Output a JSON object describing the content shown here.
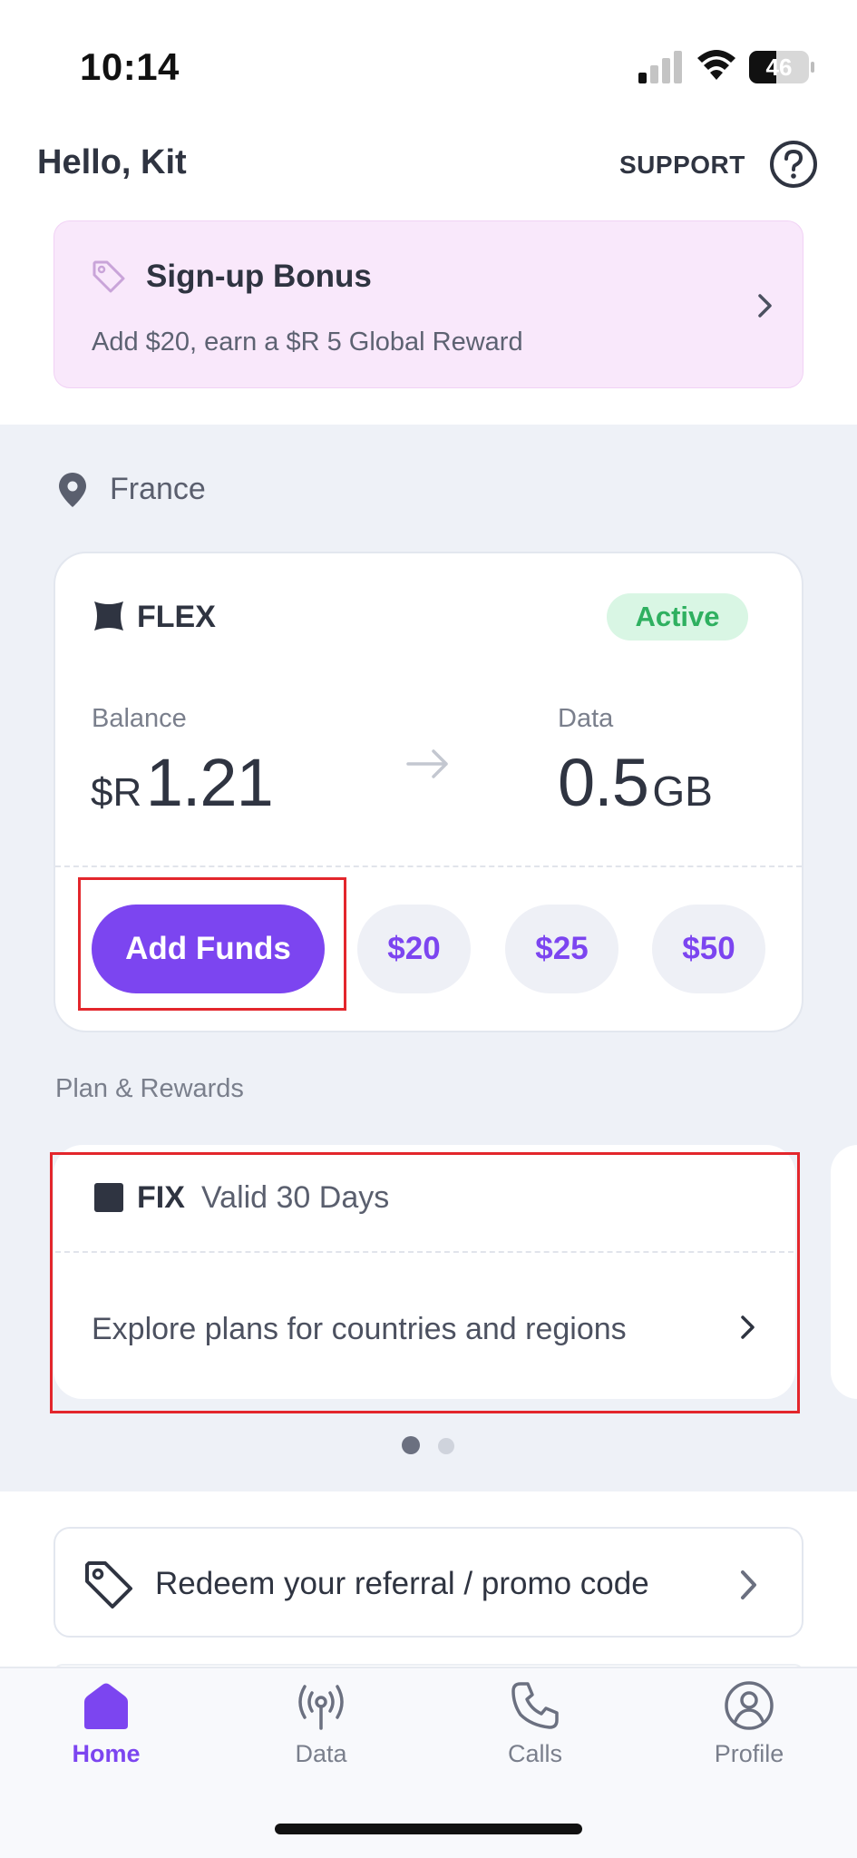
{
  "status_bar": {
    "time": "10:14",
    "battery": "46",
    "battery_level": 0.46
  },
  "header": {
    "greeting": "Hello, Kit",
    "support_label": "SUPPORT"
  },
  "bonus": {
    "title": "Sign-up Bonus",
    "subtitle": "Add $20, earn a $R 5 Global Reward"
  },
  "location": {
    "country": "France"
  },
  "flex_card": {
    "plan_name": "FLEX",
    "status": "Active",
    "balance_label": "Balance",
    "balance_currency": "$R",
    "balance_value": "1.21",
    "data_label": "Data",
    "data_value": "0.5",
    "data_unit": "GB",
    "add_funds_label": "Add Funds",
    "amounts": [
      "$20",
      "$25",
      "$50"
    ]
  },
  "plans": {
    "section_title": "Plan & Rewards",
    "fix_name": "FIX",
    "fix_validity": "Valid 30 Days",
    "explore_label": "Explore plans for countries and regions",
    "page_count": 2,
    "current_page": 1
  },
  "redeem": {
    "label": "Redeem your referral / promo code"
  },
  "tabs": [
    {
      "label": "Home",
      "icon": "home-icon",
      "active": true
    },
    {
      "label": "Data",
      "icon": "antenna-icon",
      "active": false
    },
    {
      "label": "Calls",
      "icon": "phone-icon",
      "active": false
    },
    {
      "label": "Profile",
      "icon": "profile-icon",
      "active": false
    }
  ],
  "colors": {
    "accent": "#7c45f0",
    "active_badge_bg": "#d9f6e4",
    "active_badge_text": "#2fb060",
    "bonus_bg": "#f9e8fb",
    "section_bg": "#eef1f7",
    "highlight_box": "#e3262c"
  }
}
